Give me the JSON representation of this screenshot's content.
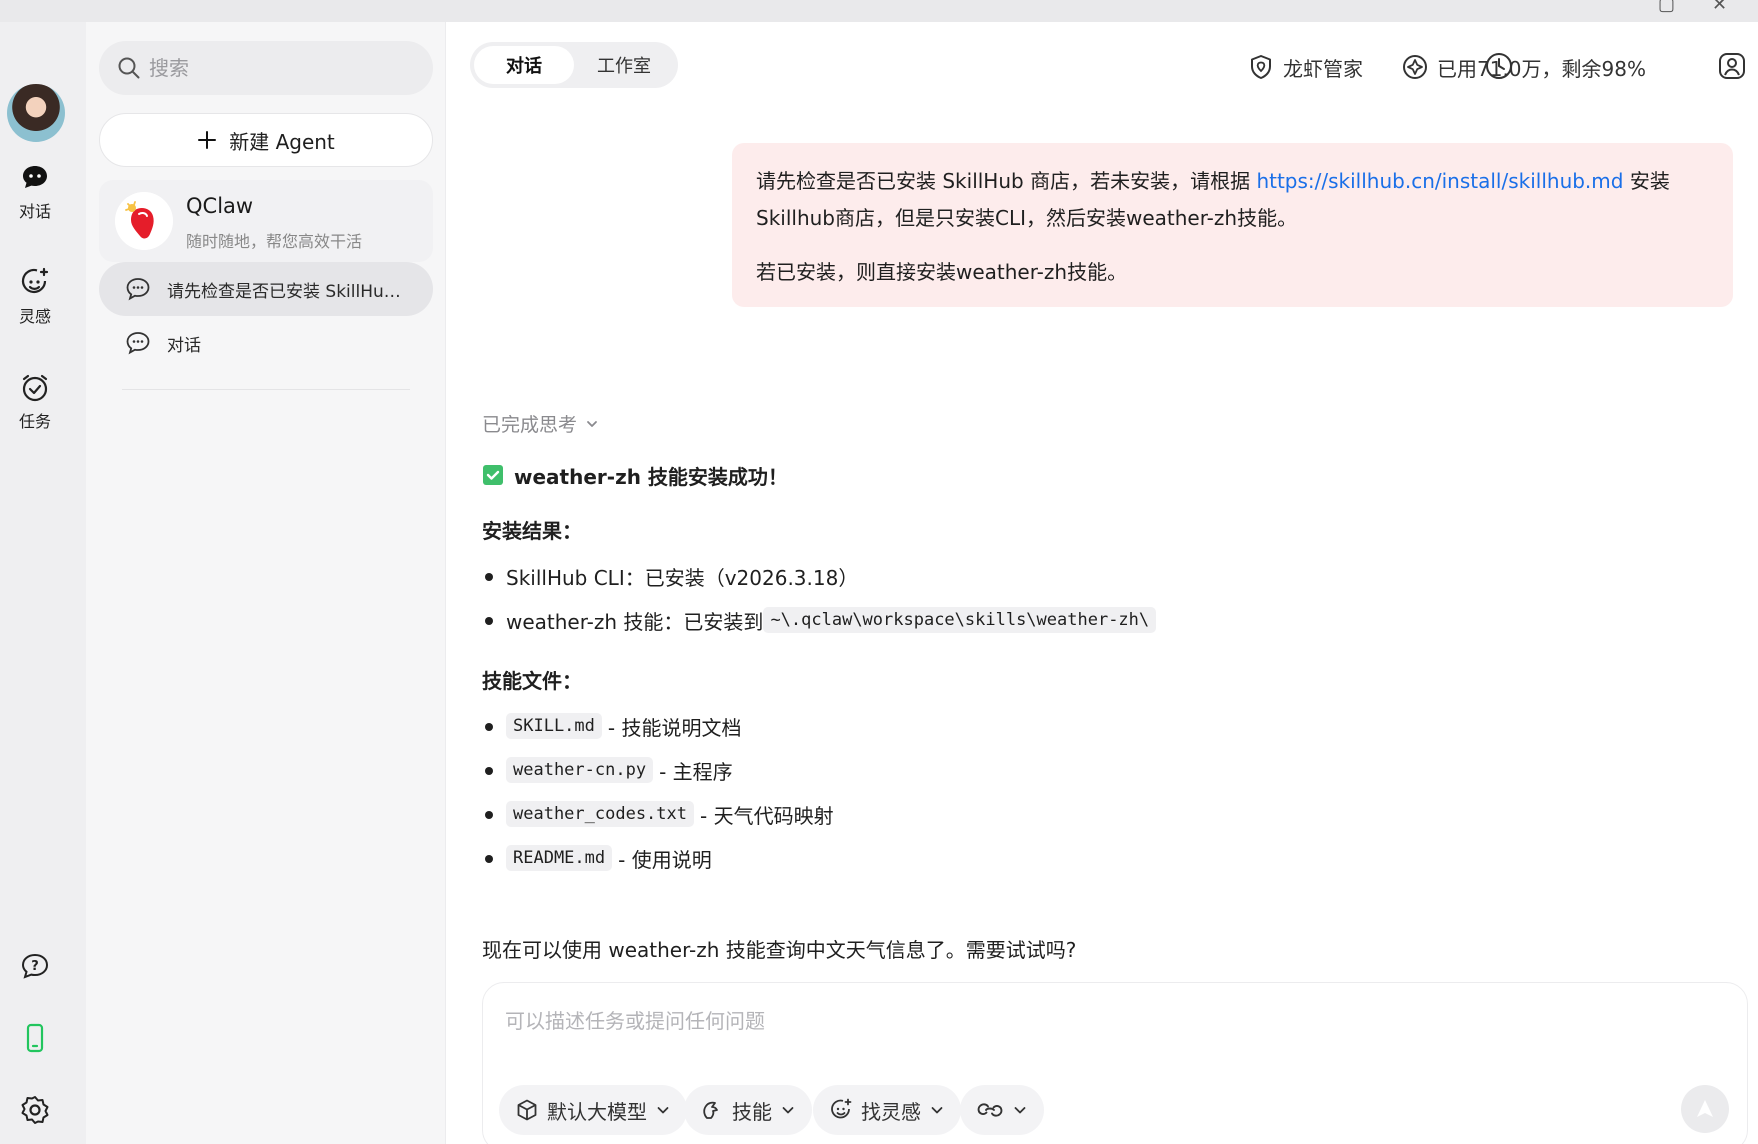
{
  "rail": {
    "items": [
      {
        "label": "对话",
        "icon": "chat-bubble-icon"
      },
      {
        "label": "灵感",
        "icon": "inspiration-face-icon"
      },
      {
        "label": "任务",
        "icon": "task-clock-icon"
      }
    ],
    "bottom_icons": [
      "help-icon",
      "phone-icon",
      "settings-icon"
    ]
  },
  "sidebar": {
    "search_placeholder": "搜索",
    "new_agent_label": "新建 Agent",
    "agent": {
      "name": "QClaw",
      "desc": "随时随地，帮您高效干活"
    },
    "chats": [
      {
        "title": "请先检查是否已安装 SkillHub 商店，若未安装，请根据",
        "active": true
      },
      {
        "title": "对话",
        "active": false
      }
    ]
  },
  "header": {
    "tabs": [
      {
        "label": "对话",
        "active": true
      },
      {
        "label": "工作室",
        "active": false
      }
    ],
    "manager_label": "龙虾管家",
    "usage_label": "已用71.0万，剩余98%"
  },
  "user_message": {
    "line1_prefix": "请先检查是否已安装 SkillHub 商店，若未安装，请根据 ",
    "link": "https://skillhub.cn/install/skillhub.md",
    "line1_suffix": " 安装Skillhub商店，但是只安装CLI，然后安装weather-zh技能。",
    "line2": "若已安装，则直接安装weather-zh技能。"
  },
  "reply": {
    "thinking_label": "已完成思考",
    "headline": "weather-zh 技能安装成功！",
    "result_heading": "安装结果：",
    "results": [
      {
        "text": "SkillHub CLI：已安装（v2026.3.18）",
        "code": ""
      },
      {
        "text": "weather-zh 技能：已安装到 ",
        "code": "~\\.qclaw\\workspace\\skills\\weather-zh\\"
      }
    ],
    "files_heading": "技能文件：",
    "files": [
      {
        "code": "SKILL.md",
        "desc": "- 技能说明文档"
      },
      {
        "code": "weather-cn.py",
        "desc": "- 主程序"
      },
      {
        "code": "weather_codes.txt",
        "desc": "- 天气代码映射"
      },
      {
        "code": "README.md",
        "desc": "- 使用说明"
      }
    ],
    "closing": "现在可以使用 weather-zh 技能查询中文天气信息了。需要试试吗?"
  },
  "composer": {
    "placeholder": "可以描述任务或提问任何问题",
    "model_label": "默认大模型",
    "skills_label": "技能",
    "inspiration_label": "找灵感"
  },
  "colors": {
    "accent_link": "#1a6fe8",
    "user_bubble": "#fdecec",
    "success_check": "#3fbf6b",
    "phone_icon": "#22c55e"
  }
}
